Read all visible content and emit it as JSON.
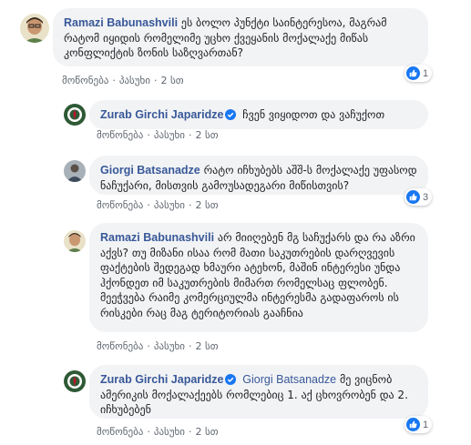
{
  "comments": [
    {
      "author": "Ramazi Babunashvili",
      "text": "ეს ბოლო პუნქტი საინტერესოა, მაგრამ რატომ იყიდის რომელიმე უცხო ქვეყანის მოქალაქე მიწას კონფლიქტის ზონის საზღვართან?",
      "actions": {
        "like": "მოწონება",
        "reply": "პასუხი",
        "time": "2 სთ"
      },
      "reaction_count": "1"
    },
    {
      "author": "Zurab Girchi Japaridze",
      "text": "ჩვენ ვიყიდოთ და ვაჩუქოთ",
      "actions": {
        "like": "მოწონება",
        "reply": "პასუხი",
        "time": "2 სთ"
      }
    },
    {
      "author": "Giorgi Batsanadze",
      "text": "რატო იჩხუბებს აშშ-ს მოქალაქე უფასოდ ნაჩუქარი, მისთვის გამოუსადეგარი მიწისთვის?",
      "actions": {
        "like": "მოწონება",
        "reply": "პასუხი",
        "time": "2 სთ"
      },
      "reaction_count": "3"
    },
    {
      "author": "Ramazi Babunashvili",
      "text": "არ მიიღებენ მგ საჩუქარს და რა აზრი აქვს? თუ მიზანი ისაა რომ მათი საკუთრების დარღვევის ფაქტების შედეგად ხმაური ატეხონ, მაშინ ინტერესი უნდა ჰქონდეთ იმ საკუთრების მიმართ რომელსაც ფლობენ. მეეჭვება რაიმე კომერციულმა ინტერესმა გადაფაროს ის რისკები რაც მაგ ტერიტორიას გააჩნია",
      "actions": {
        "like": "მოწონება",
        "reply": "პასუხი",
        "time": "2 სთ"
      }
    },
    {
      "author": "Zurab Girchi Japaridze",
      "mention": "Giorgi Batsanadze",
      "text": "მე ვიცნობ ამერიკის მოქალაქეებს რომლებიც 1. აქ ცხოვრობენ და 2. იჩხუბებენ",
      "actions": {
        "like": "მოწონება",
        "reply": "პასუხი",
        "time": "2 სთ"
      },
      "reaction_count": "1"
    }
  ],
  "colors": {
    "author_link": "#385898",
    "bubble_bg": "#f2f3f5",
    "action_text": "#606770",
    "like_blue": "#1877f2"
  },
  "icons": {
    "verified": "verified-badge-icon",
    "like": "thumbs-up-icon"
  }
}
